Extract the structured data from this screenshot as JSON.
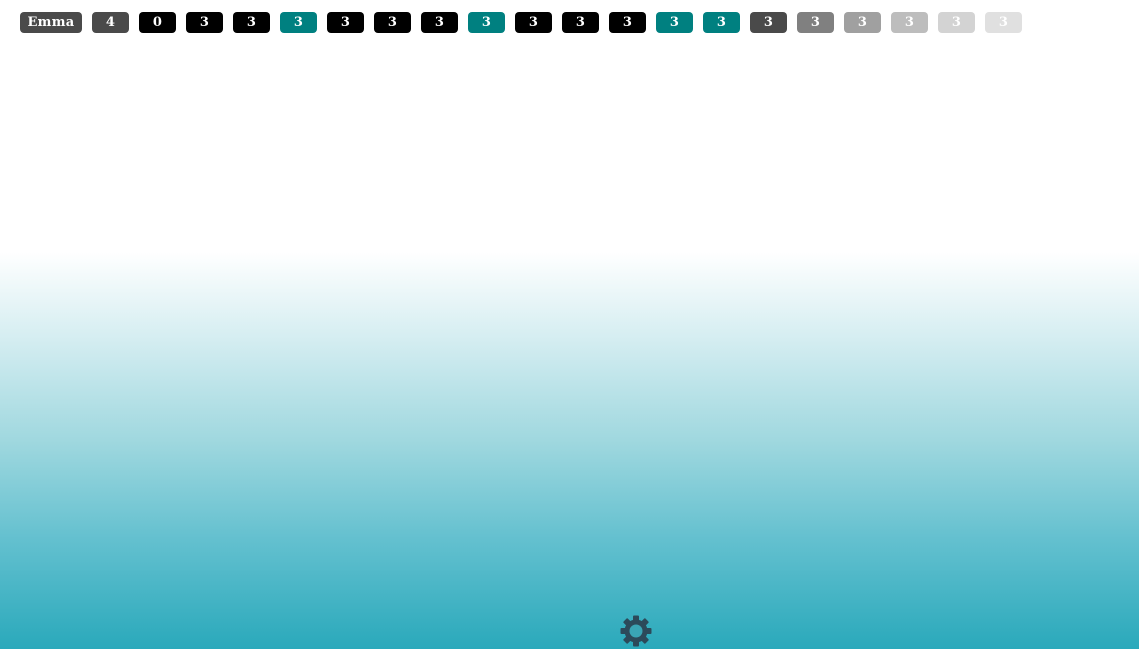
{
  "chips": [
    {
      "label": "Emma",
      "color": "#4a4a4a",
      "kind": "name"
    },
    {
      "label": "4",
      "color": "#4a4a4a",
      "kind": "num"
    },
    {
      "label": "0",
      "color": "#000000",
      "kind": "num"
    },
    {
      "label": "3",
      "color": "#000000",
      "kind": "num"
    },
    {
      "label": "3",
      "color": "#000000",
      "kind": "num"
    },
    {
      "label": "3",
      "color": "#008080",
      "kind": "num"
    },
    {
      "label": "3",
      "color": "#000000",
      "kind": "num"
    },
    {
      "label": "3",
      "color": "#000000",
      "kind": "num"
    },
    {
      "label": "3",
      "color": "#000000",
      "kind": "num"
    },
    {
      "label": "3",
      "color": "#008080",
      "kind": "num"
    },
    {
      "label": "3",
      "color": "#000000",
      "kind": "num"
    },
    {
      "label": "3",
      "color": "#000000",
      "kind": "num"
    },
    {
      "label": "3",
      "color": "#000000",
      "kind": "num"
    },
    {
      "label": "3",
      "color": "#008080",
      "kind": "num"
    },
    {
      "label": "3",
      "color": "#008080",
      "kind": "num"
    },
    {
      "label": "3",
      "color": "#4a4a4a",
      "kind": "num"
    },
    {
      "label": "3",
      "color": "#808080",
      "kind": "num"
    },
    {
      "label": "3",
      "color": "#a0a0a0",
      "kind": "num"
    },
    {
      "label": "3",
      "color": "#bdbdbd",
      "kind": "num"
    },
    {
      "label": "3",
      "color": "#d3d3d3",
      "kind": "num"
    },
    {
      "label": "3",
      "color": "#e0e0e0",
      "kind": "num"
    }
  ],
  "settings": {
    "icon": "gear-icon",
    "color": "#2c4a5a"
  }
}
